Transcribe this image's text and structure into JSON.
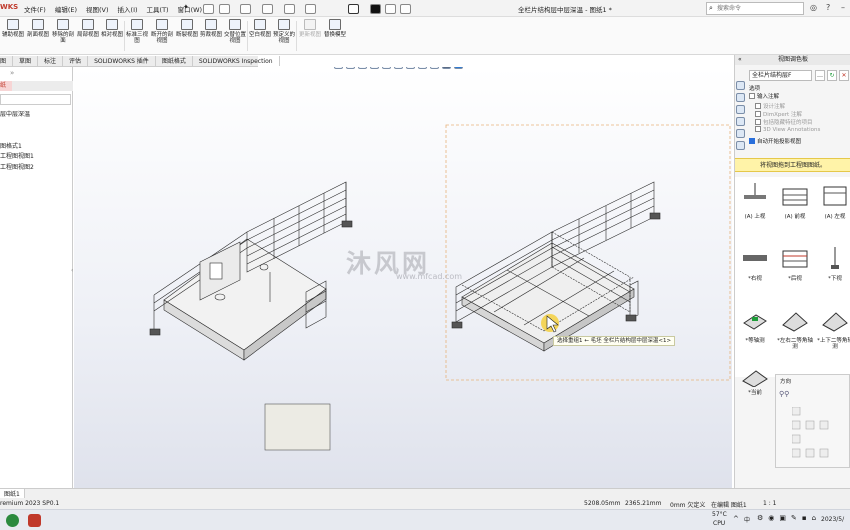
{
  "app": {
    "brand": "WKS",
    "menu": [
      "文件(F)",
      "编辑(E)",
      "视图(V)",
      "插入(I)",
      "工具(T)",
      "窗口(W)"
    ],
    "doc_title": "全栏片结构层中层深温 - 图纸1 *",
    "search_placeholder": "搜索命令"
  },
  "ribbon": {
    "buttons": [
      "辅助视图",
      "剖面视图",
      "移除的剖面",
      "局部视图",
      "相对视图",
      "标准三视图",
      "断开的剖视图",
      "断裂视图",
      "剪裁视图",
      "交替位置视图",
      "空白视图",
      "预定义的视图",
      "更新视图",
      "替换模型"
    ]
  },
  "tabs": [
    "草图",
    "标注",
    "评估",
    "SOLIDWORKS 插件",
    "图纸格式",
    "SOLIDWORKS Inspection"
  ],
  "tabs_first": "图",
  "left_panel": {
    "active_tab": "纸",
    "items": [
      "层中层深温",
      "图格式1",
      "工程图视图1",
      "工程图视图2"
    ]
  },
  "view_palette": {
    "title": "视图调色板",
    "model": "全栏片结构层F",
    "options_title": "选项",
    "options": [
      {
        "label": "输入注解",
        "checked": false,
        "dim": false
      },
      {
        "label": "设计注解",
        "checked": false,
        "dim": true
      },
      {
        "label": "DimXpert 注解",
        "checked": false,
        "dim": true
      },
      {
        "label": "包括隐藏特征的项目",
        "checked": false,
        "dim": true
      },
      {
        "label": "3D View Annotations",
        "checked": false,
        "dim": true
      },
      {
        "label": "自动开始投影视图",
        "checked": true,
        "dim": false
      }
    ],
    "banner": "将视图拖到工程图图纸。",
    "views": [
      "(A) 上视",
      "(A) 前视",
      "(A) 左视",
      "*右视",
      "*后视",
      "*下视",
      "*等轴测",
      "*左右二等角轴测",
      "*上下二等角轴测",
      "*当前"
    ],
    "orientation_title": "方向"
  },
  "canvas": {
    "watermark": "沐风网",
    "watermark_sub": "www.mfcad.com",
    "tooltip": "选择重组1 ← 毛坯 全栏片结构层中层深温<1>"
  },
  "status": {
    "sheet_tab": "图纸1",
    "product": "remium 2023 SP0.1",
    "x": "5208.05mm",
    "y": "2365.21mm",
    "z": "0mm 欠定义",
    "editing": "在编辑 图纸1",
    "scale": "1 : 1"
  },
  "taskbar": {
    "temp": "57°C",
    "cpu": "CPU",
    "ime": "中",
    "date": "2023/5/"
  },
  "colors": {
    "accent": "#2a6fdb",
    "brand": "#c0392b",
    "banner": "#fff3a8",
    "selection_box": "#e7b27b"
  }
}
